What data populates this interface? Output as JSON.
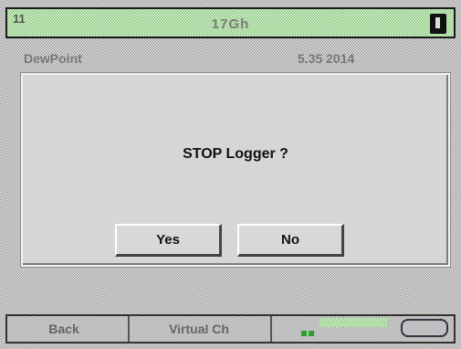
{
  "header": {
    "channel_number": "11",
    "title": "17Gh"
  },
  "background": {
    "row_left": "DewPoint",
    "row_right": "5.35 2014"
  },
  "dialog": {
    "question": "STOP Logger ?",
    "yes_label": "Yes",
    "no_label": "No"
  },
  "footer": {
    "back_label": "Back",
    "virtual_label": "Virtual Ch"
  },
  "colors": {
    "header_green": "#7cc36e",
    "dialog_bg": "#d6d6d6"
  }
}
